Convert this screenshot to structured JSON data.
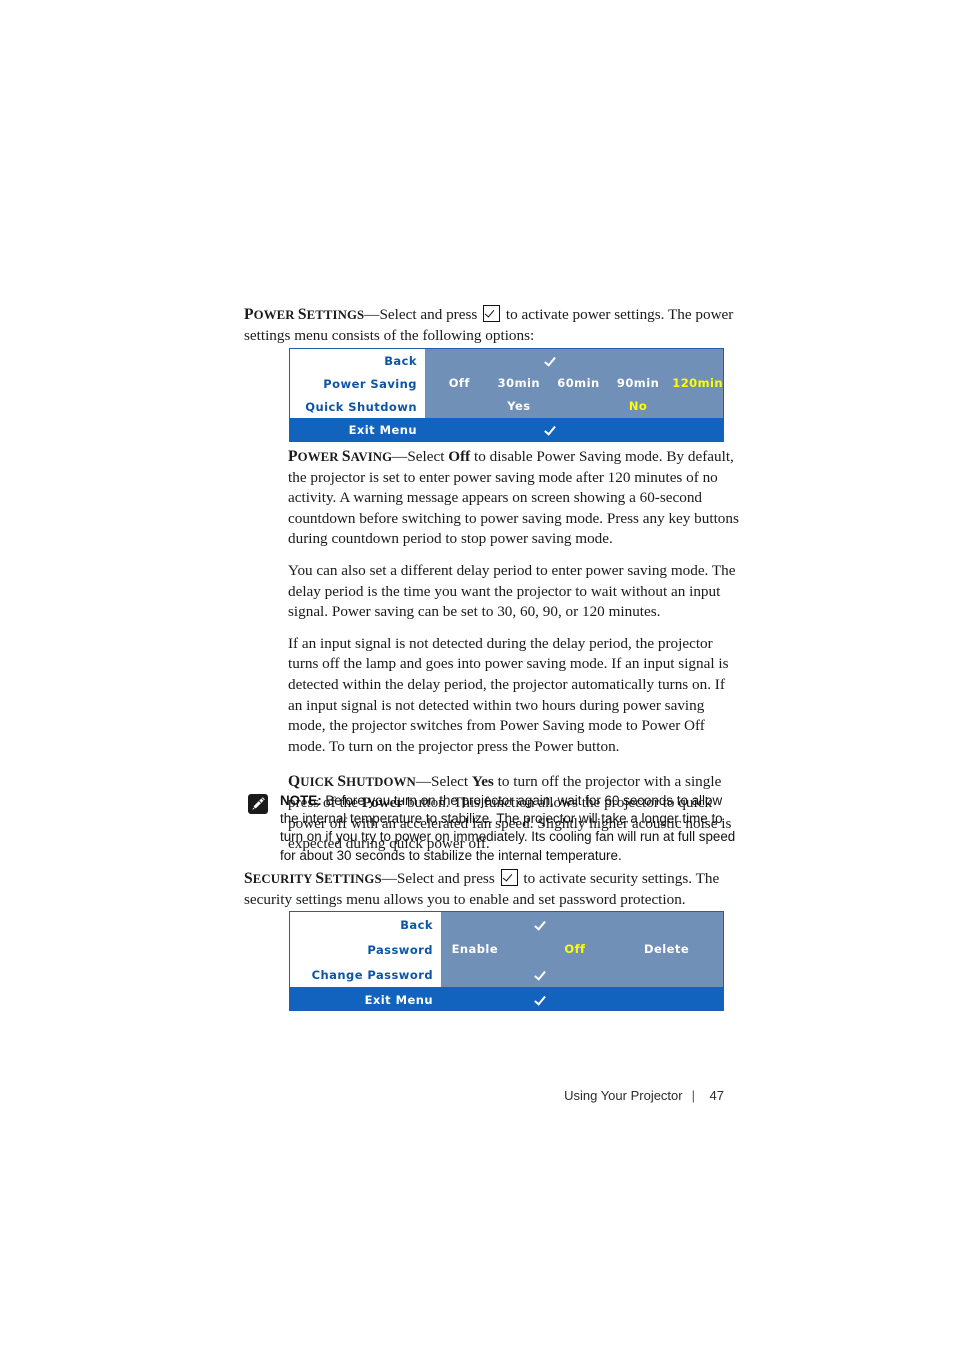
{
  "page": {
    "footer_section": "Using Your Projector",
    "footer_separator": "|",
    "page_number": "47"
  },
  "colors": {
    "osd_label_blue": "#0d56a6",
    "osd_panel_blue": "#7190b8",
    "osd_exit_blue": "#1263bd",
    "osd_border": "#1f5fad",
    "osd_selected_yellow": "#ffff00",
    "osd_text_white": "#ffffff"
  },
  "power_settings": {
    "heading_cap": "P",
    "heading_rest": "OWER ",
    "heading_cap2": "S",
    "heading_rest2": "ETTINGS",
    "dash": "—",
    "intro_before_icon": "Select and press ",
    "icon_name": "checkbox-check-icon",
    "intro_after_icon": " to activate power settings. The power settings menu consists of the following options:"
  },
  "power_menu": {
    "name": "power-settings-osd",
    "rows": [
      {
        "label": "Back",
        "type": "check",
        "check_x_pct": 42
      },
      {
        "label": "Power Saving",
        "type": "options",
        "options": [
          {
            "text": "Off",
            "x_pct": 11.5,
            "selected": false
          },
          {
            "text": "30min",
            "x_pct": 31.5,
            "selected": false
          },
          {
            "text": "60min",
            "x_pct": 51.5,
            "selected": false
          },
          {
            "text": "90min",
            "x_pct": 71.5,
            "selected": false
          },
          {
            "text": "120min",
            "x_pct": 91.5,
            "selected": true
          }
        ]
      },
      {
        "label": "Quick Shutdown",
        "type": "options",
        "options": [
          {
            "text": "Yes",
            "x_pct": 31.5,
            "selected": false
          },
          {
            "text": "No",
            "x_pct": 71.5,
            "selected": true
          }
        ]
      }
    ],
    "exit_label": "Exit Menu",
    "exit_check_x_pct": 42
  },
  "power_saving": {
    "heading_cap": "P",
    "heading_rest": "OWER ",
    "heading_cap2": "S",
    "heading_rest2": "AVING",
    "dash": "—",
    "p1_a": "Select ",
    "p1_bold": "Off",
    "p1_b": " to disable Power Saving mode. By default, the projector is set to enter power saving mode after 120 minutes of no activity. A warning message appears on screen showing a 60-second countdown before switching to power saving mode. Press any key buttons during countdown period to stop power saving mode.",
    "p2": "You can also set a different delay period to enter power saving mode. The delay period is the time you want the projector to wait without an input signal. Power saving can be set to 30, 60, 90, or 120 minutes.",
    "p3": "If an input signal is not detected during the delay period, the projector turns off the lamp and goes into power saving mode. If an input signal is detected within the delay period, the projector automatically turns on. If an input signal is not detected within two hours during power saving mode, the projector switches from Power Saving mode to Power Off mode. To turn on the projector press the Power button."
  },
  "quick_shutdown": {
    "heading_cap": "Q",
    "heading_rest": "UICK ",
    "heading_cap2": "S",
    "heading_rest2": "HUTDOWN",
    "dash": "—",
    "t_a": "Select ",
    "t_bold1": "Yes",
    "t_b": " to turn off the projector with a single press of the ",
    "t_bold2": "Power",
    "t_c": " button. This function allows the projector to quick power off with an accelerated fan speed. Slightly higher acoustic noise is expected during quick power off."
  },
  "note": {
    "icon_name": "note-pencil-icon",
    "label": "NOTE:",
    "text": " Before you turn on the projector again, wait for 60 seconds to allow the internal temperature to stabilize. The projector will take a longer time to turn on if you try to power on immediately. Its cooling fan will run at full speed for about 30 seconds to stabilize the internal temperature."
  },
  "security_settings": {
    "heading_cap": "S",
    "heading_rest": "ECURITY ",
    "heading_cap2": "S",
    "heading_rest2": "ETTINGS",
    "dash": "—",
    "intro_before_icon": "Select and press ",
    "icon_name": "checkbox-check-icon",
    "intro_after_icon": " to activate security settings. The security settings menu allows you to enable and set password protection."
  },
  "security_menu": {
    "name": "security-settings-osd",
    "rows": [
      {
        "label": "Back",
        "type": "check",
        "check_x_pct": 35
      },
      {
        "label": "Password",
        "type": "options",
        "options": [
          {
            "text": "Enable",
            "x_pct": 12,
            "selected": false
          },
          {
            "text": "Off",
            "x_pct": 47.5,
            "selected": true
          },
          {
            "text": "Delete",
            "x_pct": 80,
            "selected": false
          }
        ]
      },
      {
        "label": "Change Password",
        "type": "check",
        "check_x_pct": 35
      }
    ],
    "exit_label": "Exit Menu",
    "exit_check_x_pct": 35
  }
}
